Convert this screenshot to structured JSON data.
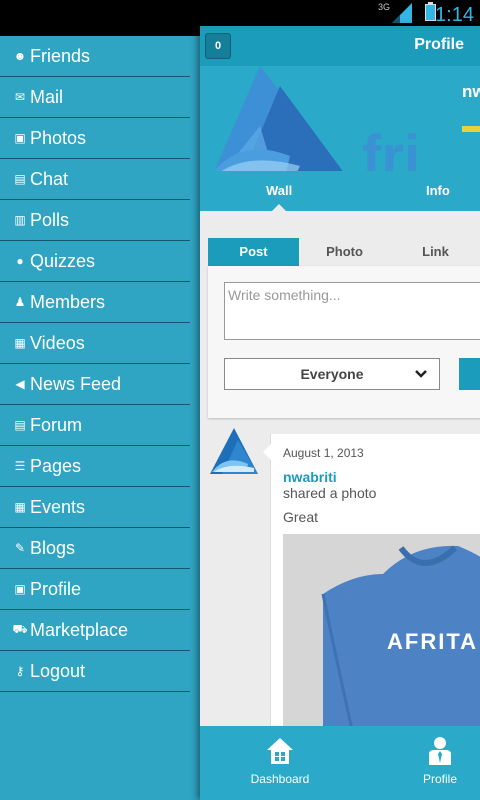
{
  "status_bar": {
    "network": "3G",
    "time": "1:14"
  },
  "drawer": {
    "items": [
      {
        "label": "Friends",
        "icon": "friends-icon",
        "glyph": "☻"
      },
      {
        "label": "Mail",
        "icon": "mail-icon",
        "glyph": "✉"
      },
      {
        "label": "Photos",
        "icon": "camera-icon",
        "glyph": "▣"
      },
      {
        "label": "Chat",
        "icon": "chat-icon",
        "glyph": "▤"
      },
      {
        "label": "Polls",
        "icon": "polls-icon",
        "glyph": "▥"
      },
      {
        "label": "Quizzes",
        "icon": "quizzes-icon",
        "glyph": "●"
      },
      {
        "label": "Members",
        "icon": "members-icon",
        "glyph": "♟"
      },
      {
        "label": "Videos",
        "icon": "videos-icon",
        "glyph": "▦"
      },
      {
        "label": "News Feed",
        "icon": "megaphone-icon",
        "glyph": "◀"
      },
      {
        "label": "Forum",
        "icon": "forum-icon",
        "glyph": "▤"
      },
      {
        "label": "Pages",
        "icon": "pages-icon",
        "glyph": "☰"
      },
      {
        "label": "Events",
        "icon": "calendar-icon",
        "glyph": "▦"
      },
      {
        "label": "Blogs",
        "icon": "blogs-icon",
        "glyph": "✎"
      },
      {
        "label": "Profile",
        "icon": "profile-card-icon",
        "glyph": "▣"
      },
      {
        "label": "Marketplace",
        "icon": "cart-icon",
        "glyph": "⛟"
      },
      {
        "label": "Logout",
        "icon": "key-icon",
        "glyph": "⚷"
      }
    ]
  },
  "header": {
    "badge": "0",
    "title": "Profile"
  },
  "cover": {
    "name": "nw",
    "logo_text": "fri"
  },
  "profile_tabs": {
    "wall": "Wall",
    "info": "Info"
  },
  "composer": {
    "tabs": {
      "post": "Post",
      "photo": "Photo",
      "link": "Link"
    },
    "placeholder": "Write something...",
    "audience": "Everyone"
  },
  "post": {
    "date": "August 1, 2013",
    "user": "nwabriti",
    "action": "shared a photo",
    "caption": "Great",
    "shirt_text": "AFRITA"
  },
  "bottom_nav": {
    "dashboard": "Dashboard",
    "profile": "Profile"
  },
  "colors": {
    "drawer_bg": "#2fa4c3",
    "accent": "#1b9cba",
    "divider": "#155a6c"
  }
}
